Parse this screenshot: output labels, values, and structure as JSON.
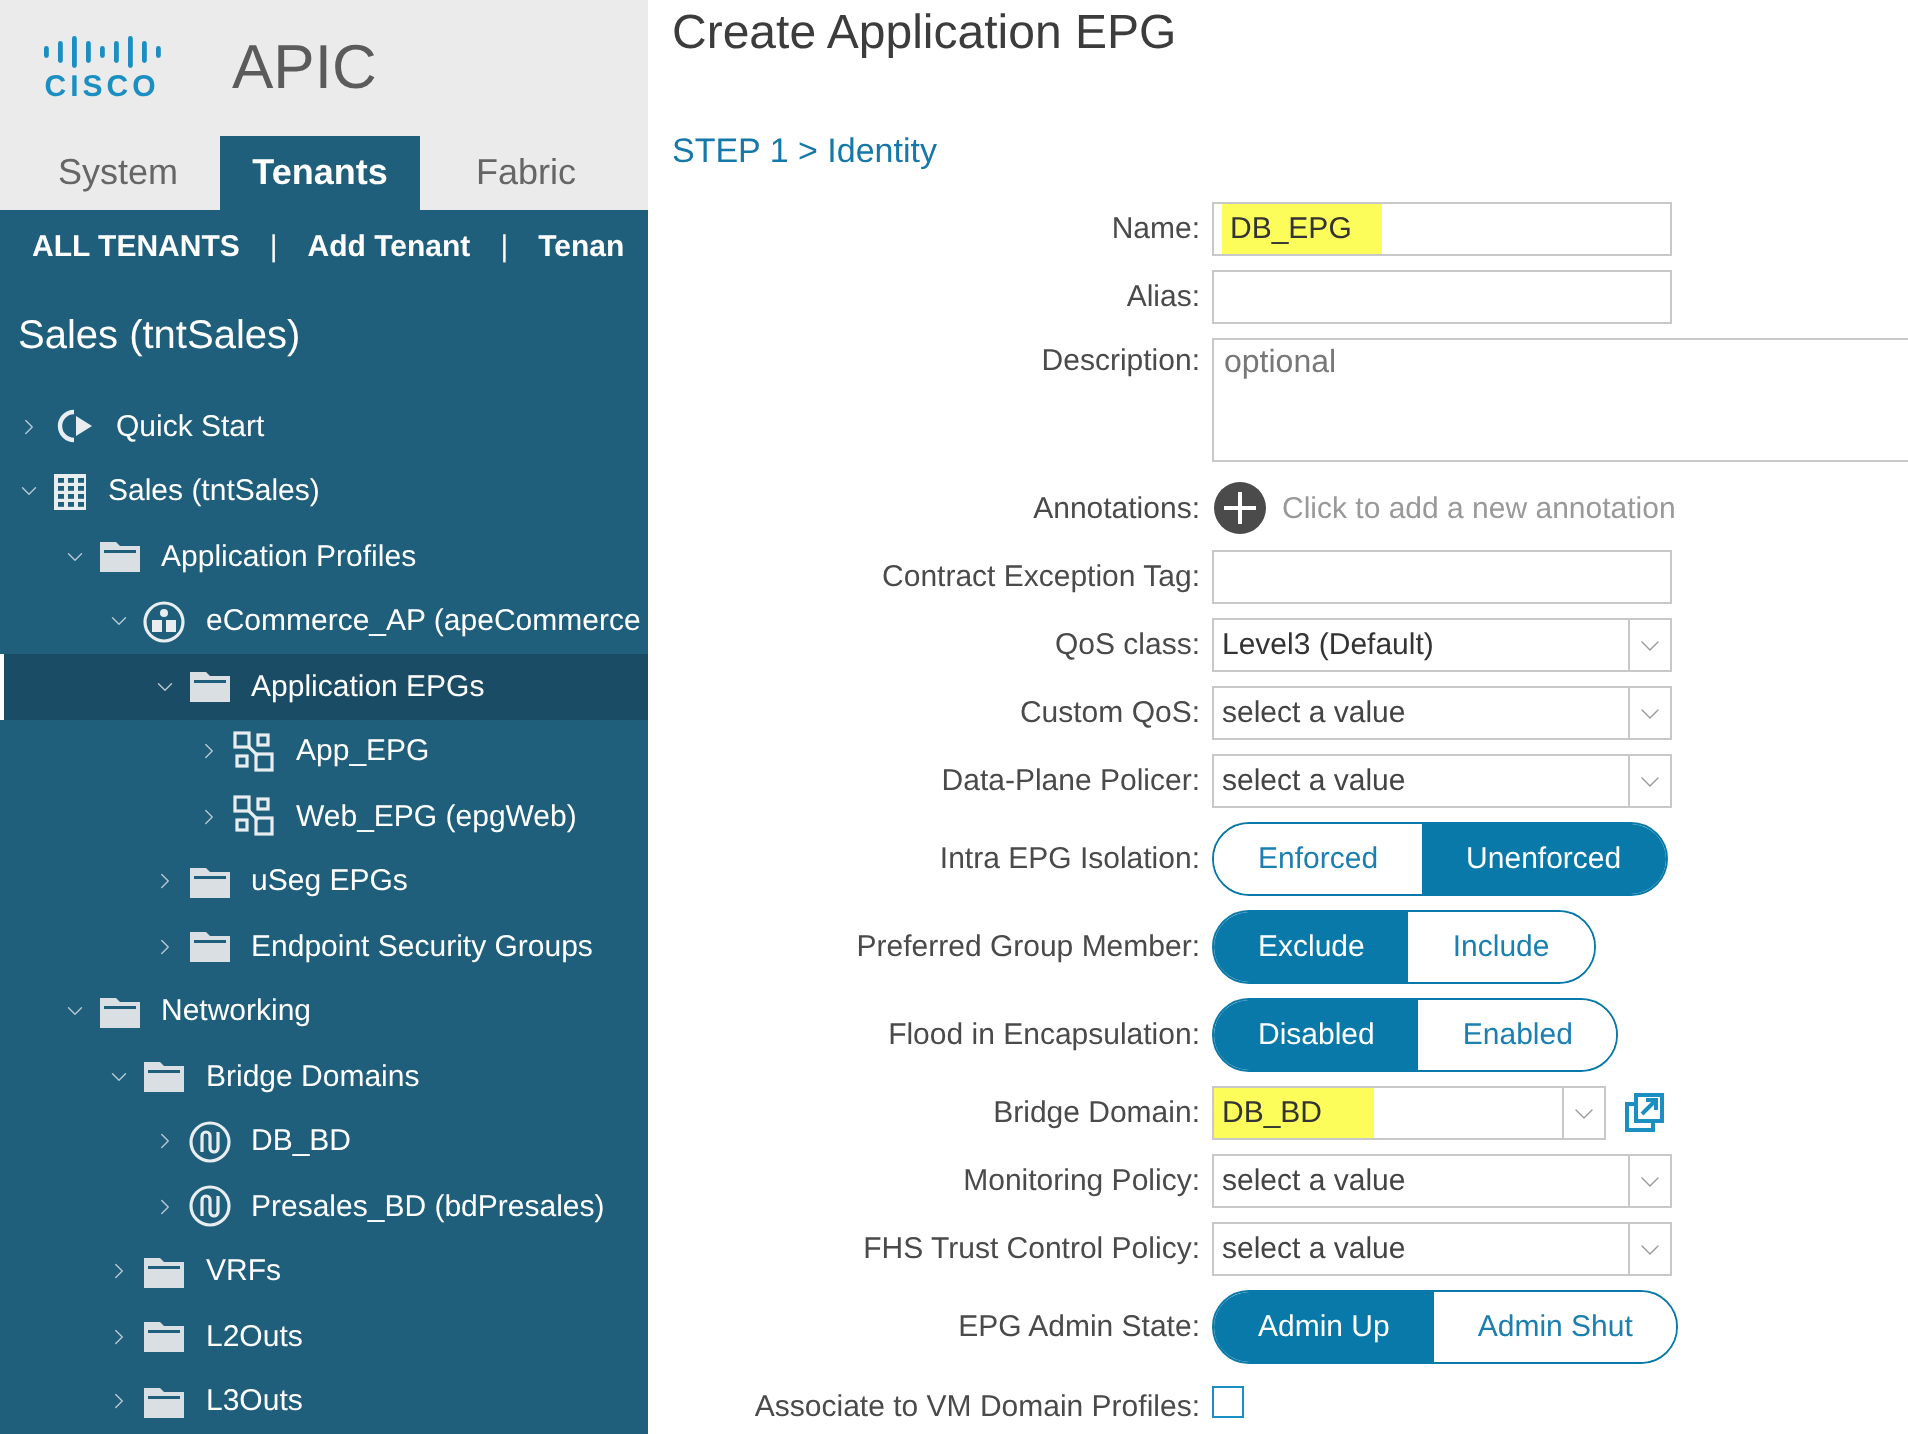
{
  "header": {
    "logo_wordmark": "CISCO",
    "product": "APIC"
  },
  "tabs": [
    {
      "label": "System",
      "selected": false
    },
    {
      "label": "Tenants",
      "selected": true
    },
    {
      "label": "Fabric",
      "selected": false
    }
  ],
  "subnav": [
    {
      "kind": "link",
      "label": "ALL TENANTS"
    },
    {
      "kind": "separator",
      "label": "|"
    },
    {
      "kind": "link",
      "label": "Add Tenant"
    },
    {
      "kind": "separator",
      "label": "|"
    },
    {
      "kind": "link",
      "label": "Tenan"
    }
  ],
  "tenant_title": "Sales (tntSales)",
  "tree": [
    {
      "label": "Quick Start",
      "kind": "quickstart",
      "expanded": false,
      "selected": false
    },
    {
      "label": "Sales (tntSales)",
      "kind": "tenant",
      "expanded": true,
      "selected": false,
      "children": [
        {
          "label": "Application Profiles",
          "kind": "folder",
          "expanded": true,
          "selected": false,
          "children": [
            {
              "label": "eCommerce_AP (apeCommerce",
              "kind": "app-profile",
              "expanded": true,
              "selected": false,
              "children": [
                {
                  "label": "Application EPGs",
                  "kind": "folder",
                  "expanded": true,
                  "selected": true,
                  "children": [
                    {
                      "label": "App_EPG",
                      "kind": "epg",
                      "expanded": false,
                      "selected": false
                    },
                    {
                      "label": "Web_EPG (epgWeb)",
                      "kind": "epg",
                      "expanded": false,
                      "selected": false
                    }
                  ]
                },
                {
                  "label": "uSeg EPGs",
                  "kind": "folder",
                  "expanded": false,
                  "selected": false
                },
                {
                  "label": "Endpoint Security Groups",
                  "kind": "folder",
                  "expanded": false,
                  "selected": false
                }
              ]
            }
          ]
        },
        {
          "label": "Networking",
          "kind": "folder",
          "expanded": true,
          "selected": false,
          "children": [
            {
              "label": "Bridge Domains",
              "kind": "folder",
              "expanded": true,
              "selected": false,
              "children": [
                {
                  "label": "DB_BD",
                  "kind": "bridge-domain",
                  "expanded": false,
                  "selected": false
                },
                {
                  "label": "Presales_BD (bdPresales)",
                  "kind": "bridge-domain",
                  "expanded": false,
                  "selected": false
                }
              ]
            },
            {
              "label": "VRFs",
              "kind": "folder",
              "expanded": false,
              "selected": false
            },
            {
              "label": "L2Outs",
              "kind": "folder",
              "expanded": false,
              "selected": false
            },
            {
              "label": "L3Outs",
              "kind": "folder",
              "expanded": false,
              "selected": false
            }
          ]
        }
      ]
    }
  ],
  "dialog": {
    "title": "Create Application EPG",
    "step": "STEP 1 > Identity"
  },
  "fields": [
    {
      "kind": "text",
      "label": "Name:",
      "value": "DB_EPG",
      "highlighted": true
    },
    {
      "kind": "text",
      "label": "Alias:"
    },
    {
      "kind": "textarea",
      "label": "Description:",
      "placeholder": "optional"
    },
    {
      "kind": "annotation",
      "label": "Annotations:",
      "hint": "Click to add a new annotation"
    },
    {
      "kind": "text",
      "label": "Contract Exception Tag:"
    },
    {
      "kind": "select",
      "label": "QoS class:",
      "value": "Level3 (Default)"
    },
    {
      "kind": "select",
      "label": "Custom QoS:",
      "placeholder": "select a value"
    },
    {
      "kind": "select",
      "label": "Data-Plane Policer:",
      "placeholder": "select a value"
    },
    {
      "kind": "toggle",
      "label": "Intra EPG Isolation:",
      "options": [
        {
          "label": "Enforced",
          "selected": false
        },
        {
          "label": "Unenforced",
          "selected": true
        }
      ]
    },
    {
      "kind": "toggle",
      "label": "Preferred Group Member:",
      "options": [
        {
          "label": "Exclude",
          "selected": true
        },
        {
          "label": "Include",
          "selected": false
        }
      ]
    },
    {
      "kind": "toggle",
      "label": "Flood in Encapsulation:",
      "options": [
        {
          "label": "Disabled",
          "selected": true
        },
        {
          "label": "Enabled",
          "selected": false
        }
      ]
    },
    {
      "kind": "select-link",
      "label": "Bridge Domain:",
      "value": "DB_BD",
      "highlighted": true
    },
    {
      "kind": "select",
      "label": "Monitoring Policy:",
      "placeholder": "select a value"
    },
    {
      "kind": "select",
      "label": "FHS Trust Control Policy:",
      "placeholder": "select a value"
    },
    {
      "kind": "toggle",
      "label": "EPG Admin State:",
      "options": [
        {
          "label": "Admin Up",
          "selected": true
        },
        {
          "label": "Admin Shut",
          "selected": false
        }
      ]
    },
    {
      "kind": "checkbox",
      "label": "Associate to VM Domain Profiles:",
      "checked": false
    }
  ]
}
